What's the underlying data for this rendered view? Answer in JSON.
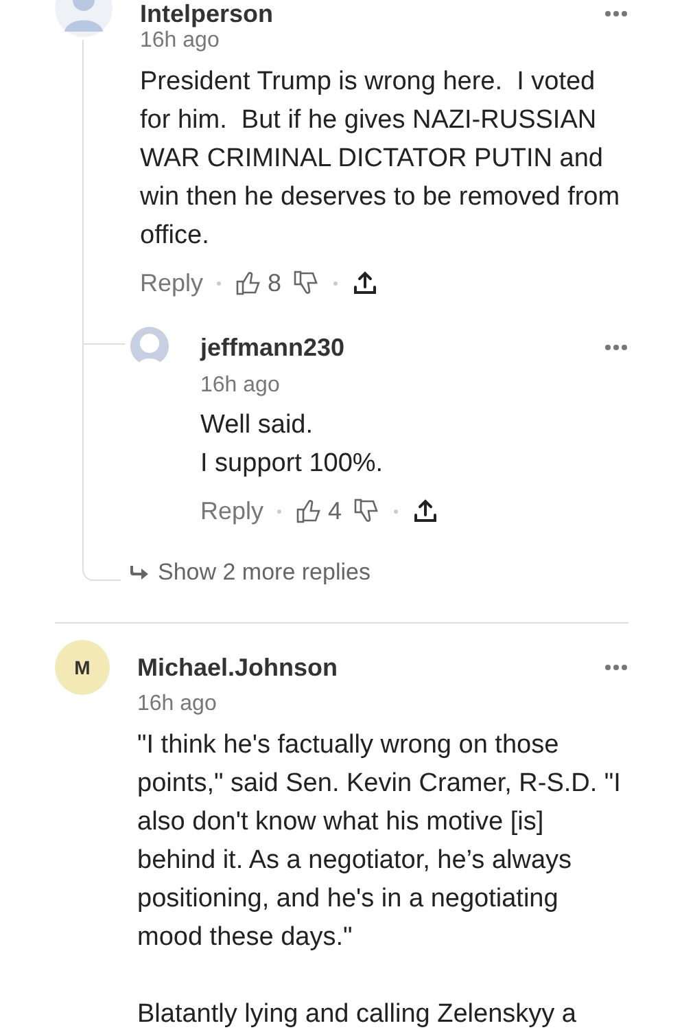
{
  "comments": [
    {
      "author": "Intelperson",
      "avatar": {
        "kind": "silhouette"
      },
      "time": "16h ago",
      "body": "President Trump is wrong here.  I voted for him.  But if he gives NAZI-RUSSIAN WAR CRIMINAL DICTATOR PUTIN and win then he deserves to be removed from office.",
      "actions": {
        "reply": "Reply",
        "likes": "8"
      },
      "replies": [
        {
          "author": "jeffmann230",
          "avatar": {
            "kind": "outline"
          },
          "time": "16h ago",
          "body": "Well said.\nI support 100%.",
          "actions": {
            "reply": "Reply",
            "likes": "4"
          }
        }
      ],
      "more_replies": "Show 2 more replies"
    },
    {
      "author": "Michael.Johnson",
      "avatar": {
        "kind": "initial",
        "initial": "M"
      },
      "time": "16h ago",
      "body": "\"I think he's factually wrong on those points,\" said Sen. Kevin Cramer, R-S.D. \"I also don't know what his motive [is] behind it. As a negotiator, he’s always positioning, and he's in a negotiating mood these days.\"\n\nBlatantly lying and calling Zelenskyy a"
    }
  ]
}
